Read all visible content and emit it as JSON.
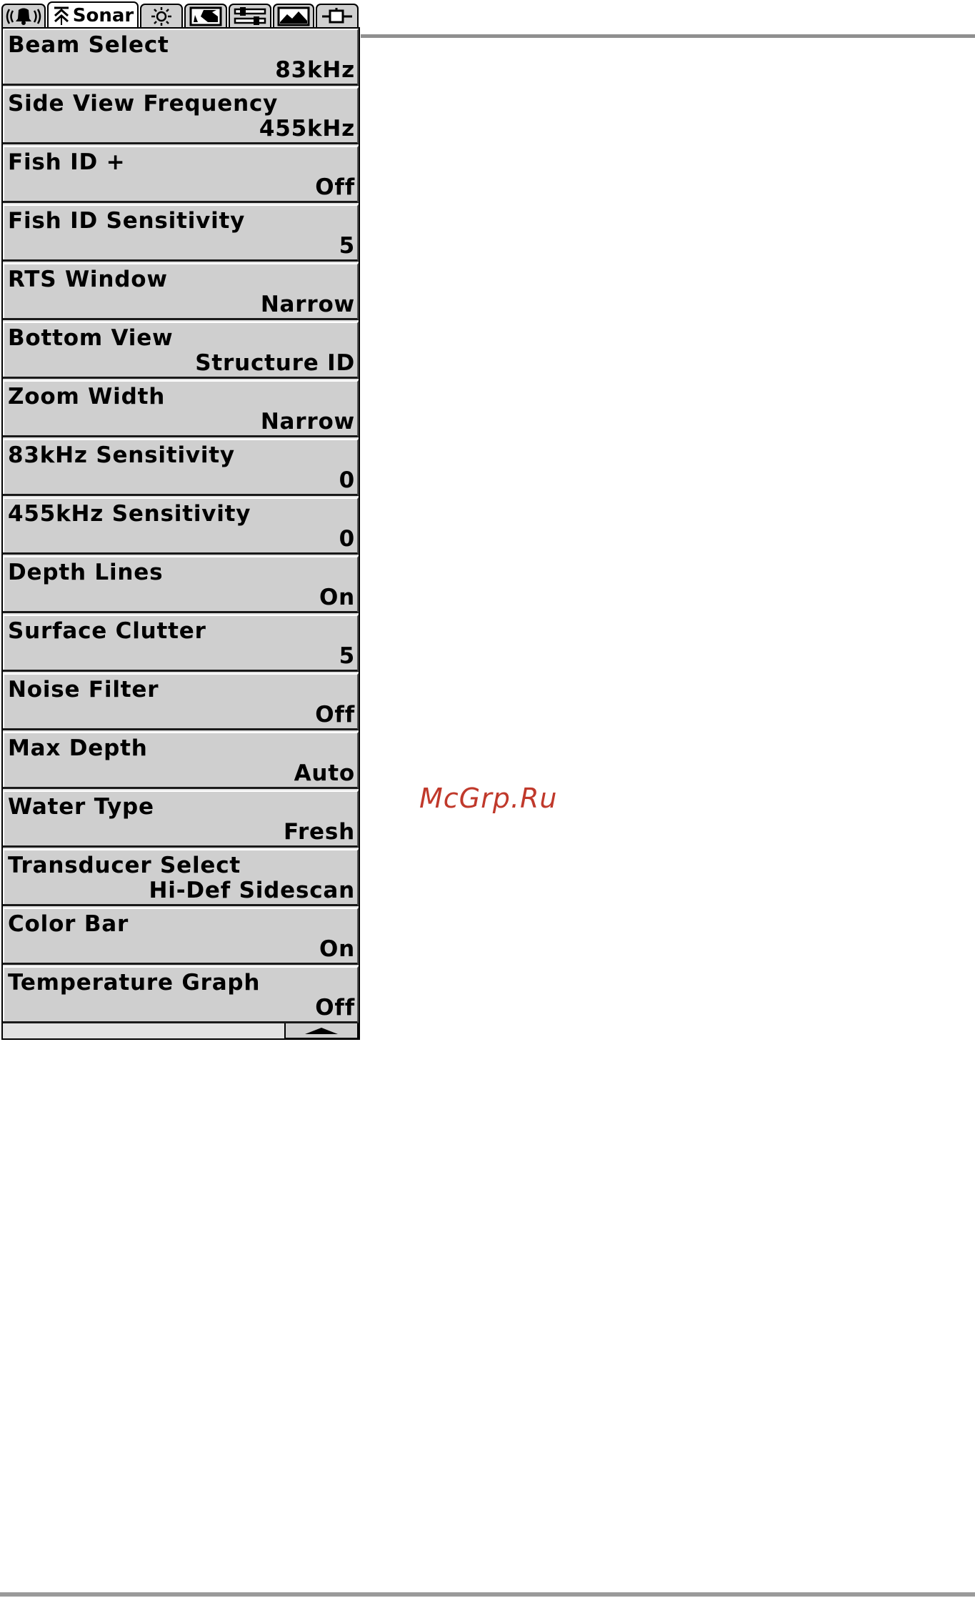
{
  "tabs": [
    {
      "icon": "alarm-bell-icon",
      "label": ""
    },
    {
      "icon": "sonar-icon",
      "label": "Sonar"
    },
    {
      "icon": "sun-settings-icon",
      "label": ""
    },
    {
      "icon": "chart-map-icon",
      "label": ""
    },
    {
      "icon": "setup-sliders-icon",
      "label": ""
    },
    {
      "icon": "views-picture-icon",
      "label": ""
    },
    {
      "icon": "accessories-plug-icon",
      "label": ""
    }
  ],
  "menu": [
    {
      "label": "Beam Select",
      "value": "83kHz"
    },
    {
      "label": "Side View Frequency",
      "value": "455kHz"
    },
    {
      "label": "Fish ID +",
      "value": "Off"
    },
    {
      "label": "Fish ID Sensitivity",
      "value": "5"
    },
    {
      "label": "RTS Window",
      "value": "Narrow"
    },
    {
      "label": "Bottom View",
      "value": "Structure ID"
    },
    {
      "label": "Zoom Width",
      "value": "Narrow"
    },
    {
      "label": "83kHz Sensitivity",
      "value": "0"
    },
    {
      "label": "455kHz Sensitivity",
      "value": "0"
    },
    {
      "label": "Depth Lines",
      "value": "On"
    },
    {
      "label": "Surface Clutter",
      "value": "5"
    },
    {
      "label": "Noise Filter",
      "value": "Off"
    },
    {
      "label": "Max Depth",
      "value": "Auto"
    },
    {
      "label": "Water Type",
      "value": "Fresh"
    },
    {
      "label": "Transducer Select",
      "value": "Hi-Def Sidescan"
    },
    {
      "label": "Color Bar",
      "value": "On"
    },
    {
      "label": "Temperature Graph",
      "value": "Off"
    }
  ],
  "scroll": {
    "icon": "scroll-up-arrow-icon"
  },
  "watermark": "McGrp.Ru"
}
